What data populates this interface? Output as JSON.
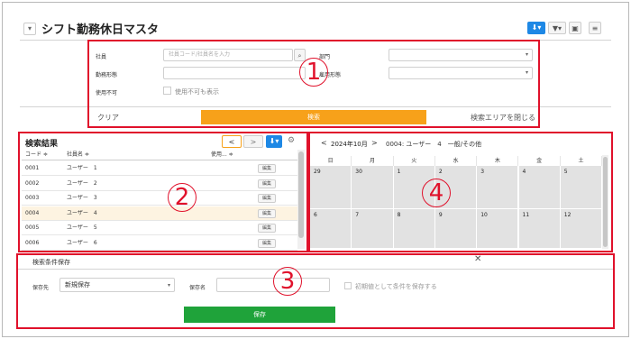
{
  "header": {
    "collapse_icon": "▾",
    "title": "シフト勤務休日マスタ",
    "download_icon": "⬇▾",
    "filter_icon": "▼▾",
    "folder_icon": "▣",
    "menu_icon": "≡"
  },
  "search": {
    "employee_label": "社員",
    "employee_placeholder": "社員コード/社員名を入力",
    "department_label": "部門",
    "work_type_label": "勤務形態",
    "employment_type_label": "雇用形態",
    "unusable_label": "使用不可",
    "show_unusable_label": "使用不可も表示",
    "clear_label": "クリア",
    "search_label": "検索",
    "close_area_label": "検索エリアを閉じる"
  },
  "results": {
    "title": "検索結果",
    "prev_icon": "<",
    "next_icon": ">",
    "columns": [
      "コード ≑",
      "社員名 ≑",
      "使用... ≑"
    ],
    "edit_label": "編集",
    "rows": [
      {
        "code": "0001",
        "name": "ユーザー　1"
      },
      {
        "code": "0002",
        "name": "ユーザー　2"
      },
      {
        "code": "0003",
        "name": "ユーザー　3"
      },
      {
        "code": "0004",
        "name": "ユーザー　4"
      },
      {
        "code": "0005",
        "name": "ユーザー　5"
      },
      {
        "code": "0006",
        "name": "ユーザー　6"
      }
    ],
    "selected_row": 3
  },
  "calendar": {
    "prev": "<",
    "month": "2024年10月",
    "next": ">",
    "info": "0004: ユーザー　4　一般/その他",
    "weekdays": [
      "日",
      "月",
      "火",
      "水",
      "木",
      "金",
      "土"
    ],
    "week1": [
      "29",
      "30",
      "1",
      "2",
      "3",
      "4",
      "5"
    ],
    "week2": [
      "6",
      "7",
      "8",
      "9",
      "10",
      "11",
      "12"
    ]
  },
  "save": {
    "title": "検索条件保存",
    "close_icon": "✕",
    "dest_label": "保存先",
    "dest_value": "新規保存",
    "name_label": "保存名",
    "default_label": "初期値として条件を保存する",
    "save_label": "保存"
  },
  "callouts": [
    "1",
    "2",
    "3",
    "4"
  ],
  "colors": {
    "accent_orange": "#f7a11a",
    "save_green": "#1fa33a",
    "primary_blue": "#1e88e5",
    "callout_red": "#e0112b"
  }
}
